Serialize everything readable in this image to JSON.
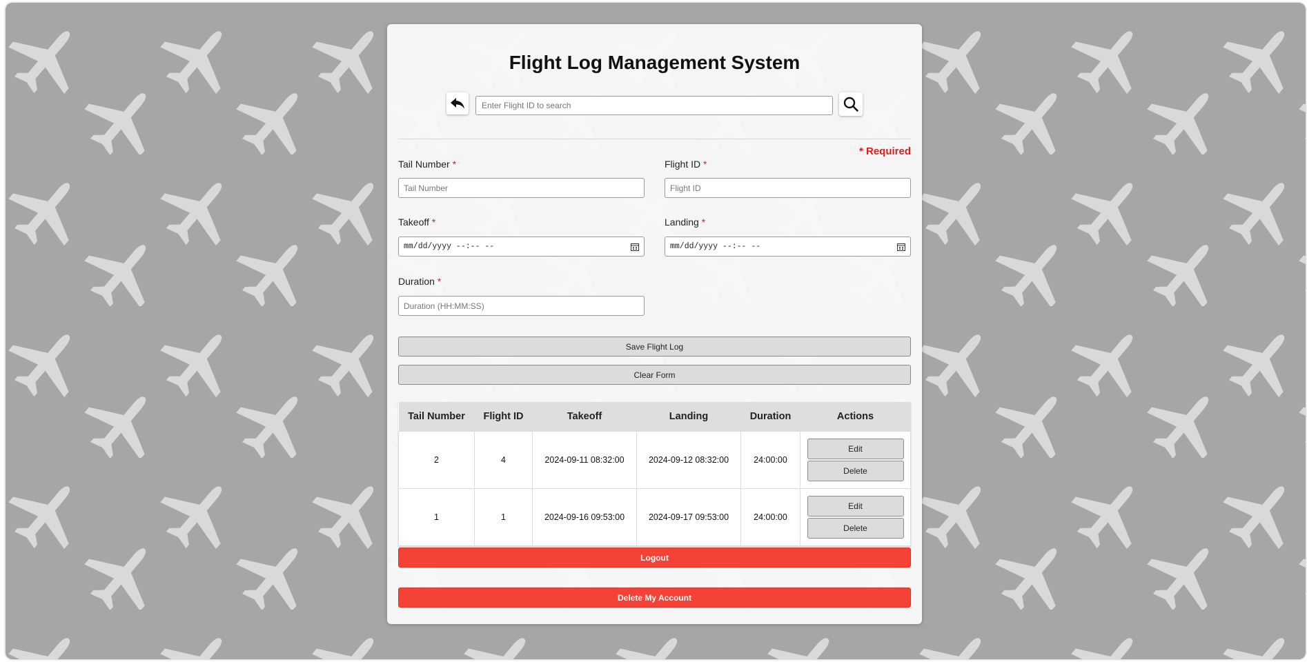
{
  "header": {
    "title": "Flight Log Management System"
  },
  "search": {
    "placeholder": "Enter Flight ID to search"
  },
  "form": {
    "required_note": "* Required",
    "tail_label": "Tail Number",
    "tail_placeholder": "Tail Number",
    "flight_label": "Flight ID",
    "flight_placeholder": "Flight ID",
    "takeoff_label": "Takeoff",
    "takeoff_value": "mm/dd/yyyy --:-- --",
    "landing_label": "Landing",
    "landing_value": "mm/dd/yyyy --:-- --",
    "duration_label": "Duration",
    "duration_placeholder": "Duration (HH:MM:SS)",
    "star": "*",
    "save_label": "Save Flight Log",
    "clear_label": "Clear Form"
  },
  "table": {
    "headers": [
      "Tail Number",
      "Flight ID",
      "Takeoff",
      "Landing",
      "Duration",
      "Actions"
    ],
    "rows": [
      {
        "tail": "2",
        "flight": "4",
        "takeoff": "2024-09-11 08:32:00",
        "landing": "2024-09-12 08:32:00",
        "duration": "24:00:00",
        "edit": "Edit",
        "delete": "Delete"
      },
      {
        "tail": "1",
        "flight": "1",
        "takeoff": "2024-09-16 09:53:00",
        "landing": "2024-09-17 09:53:00",
        "duration": "24:00:00",
        "edit": "Edit",
        "delete": "Delete"
      }
    ]
  },
  "actions": {
    "logout_label": "Logout",
    "delete_account_label": "Delete My Account"
  },
  "colors": {
    "background": "#a6a6a6",
    "danger": "#f44336",
    "required": "#e11b1b"
  },
  "icons": {
    "back": "back-arrow-icon",
    "search": "magnifier-icon",
    "calendar": "calendar-icon",
    "background": "airplane-icon"
  }
}
